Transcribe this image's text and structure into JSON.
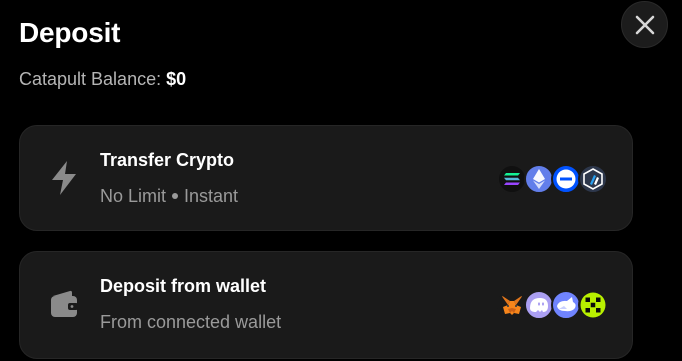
{
  "modal": {
    "title": "Deposit",
    "balance_label": "Catapult Balance:",
    "balance_value": "$0"
  },
  "options": [
    {
      "title": "Transfer Crypto",
      "subtitle_a": "No Limit",
      "subtitle_b": "Instant",
      "icon": "lightning-icon",
      "badges": [
        "solana-icon",
        "ethereum-icon",
        "base-icon",
        "arbitrum-icon"
      ]
    },
    {
      "title": "Deposit from wallet",
      "subtitle": "From connected wallet",
      "icon": "wallet-icon",
      "badges": [
        "metamask-icon",
        "phantom-icon",
        "rabby-icon",
        "okx-wallet-icon"
      ]
    }
  ],
  "colors": {
    "background": "#000000",
    "card": "#1a1a1a",
    "muted_text": "#9a9a9a"
  }
}
